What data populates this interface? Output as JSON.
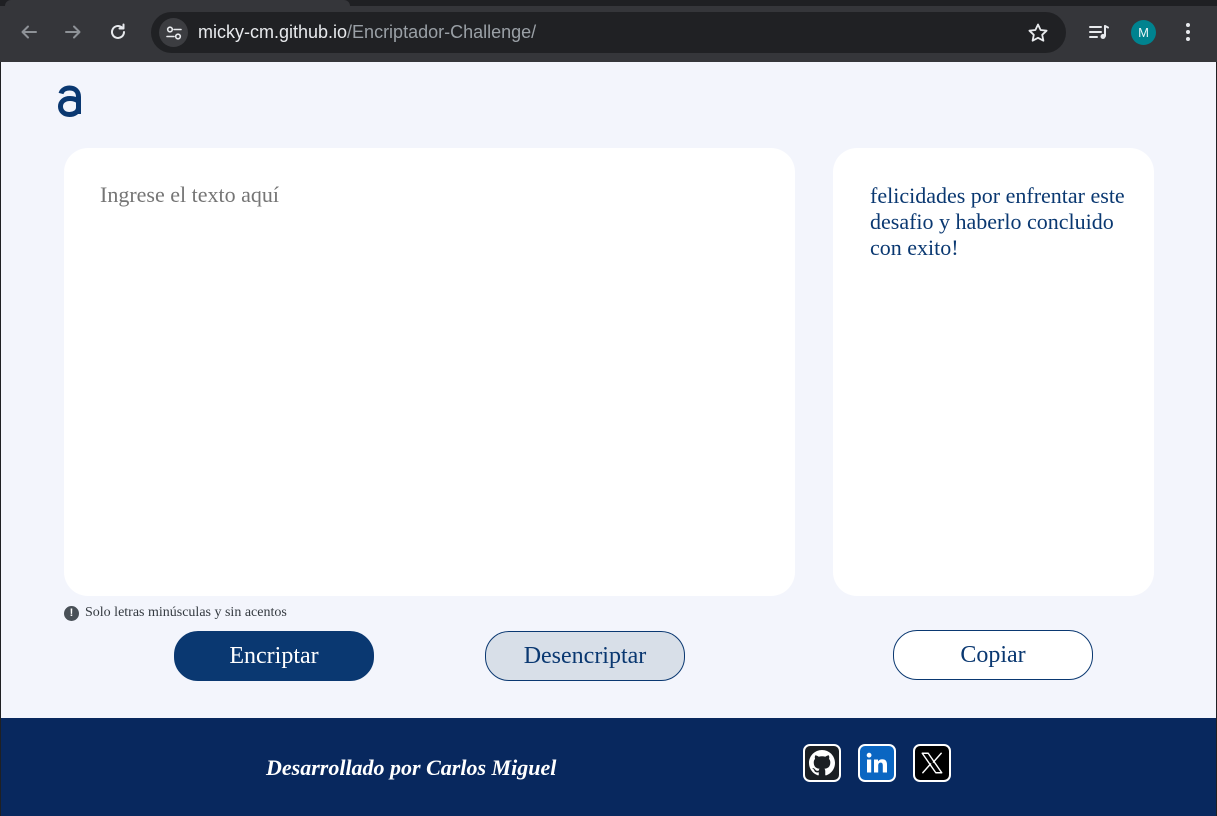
{
  "browser": {
    "url_host": "micky-cm.github.io",
    "url_path": "/Encriptador-Challenge/",
    "avatar_initial": "M",
    "icons": [
      "back-icon",
      "forward-icon",
      "reload-icon",
      "site-settings-icon",
      "bookmark-star-icon",
      "reading-list-icon",
      "kebab-menu-icon"
    ]
  },
  "page": {
    "logo": "alura-logo",
    "input_placeholder": "Ingrese el texto aquí",
    "output_text": "felicidades por enfrentar este desafio y haberlo concluido con exito!",
    "hint_text": "Solo letras minúsculas y sin acentos",
    "buttons": {
      "encrypt": "Encriptar",
      "decrypt": "Desencriptar",
      "copy": "Copiar"
    }
  },
  "footer": {
    "credit": "Desarrollado por Carlos Miguel",
    "social": [
      "github-icon",
      "linkedin-icon",
      "x-icon"
    ]
  },
  "colors": {
    "brand": "#0a3871",
    "page_bg": "#f3f5fc",
    "footer_bg": "#08285e",
    "decrypt_bg": "#d8dfe8"
  }
}
